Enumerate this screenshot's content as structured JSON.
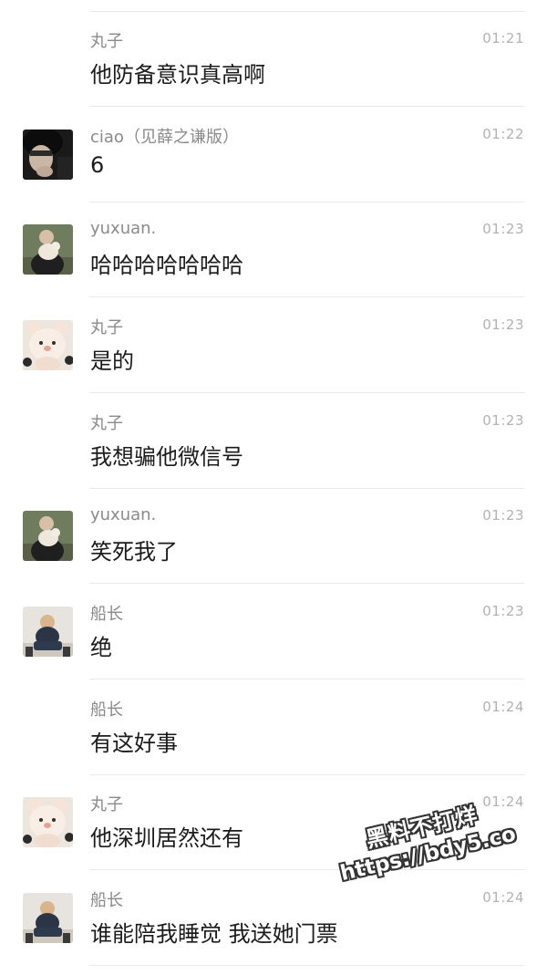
{
  "messages": [
    {
      "name": "丸子",
      "time": "01:21",
      "text": "他防备意识真高啊",
      "avatar": "none"
    },
    {
      "name": "ciao（见薛之谦版）",
      "time": "01:22",
      "text": "6",
      "avatar": "ciao"
    },
    {
      "name": "yuxuan.",
      "time": "01:23",
      "text": "哈哈哈哈哈哈哈",
      "avatar": "yuxuan"
    },
    {
      "name": "丸子",
      "time": "01:23",
      "text": "是的",
      "avatar": "wanzi"
    },
    {
      "name": "丸子",
      "time": "01:23",
      "text": "我想骗他微信号",
      "avatar": "none"
    },
    {
      "name": "yuxuan.",
      "time": "01:23",
      "text": "笑死我了",
      "avatar": "yuxuan"
    },
    {
      "name": "船长",
      "time": "01:23",
      "text": "绝",
      "avatar": "chuanzhang"
    },
    {
      "name": "船长",
      "time": "01:24",
      "text": "有这好事",
      "avatar": "none"
    },
    {
      "name": "丸子",
      "time": "01:24",
      "text": "他深圳居然还有",
      "avatar": "wanzi"
    },
    {
      "name": "船长",
      "time": "01:24",
      "text": "谁能陪我睡觉 我送她门票",
      "avatar": "chuanzhang"
    }
  ],
  "watermark": {
    "line1": "黑料不打烊",
    "line2": "https://bdy5.co"
  },
  "colors": {
    "name": "#8a8a8a",
    "time": "#b2b2b2",
    "text": "#1b1b1b",
    "divider": "#e9e9e9"
  }
}
